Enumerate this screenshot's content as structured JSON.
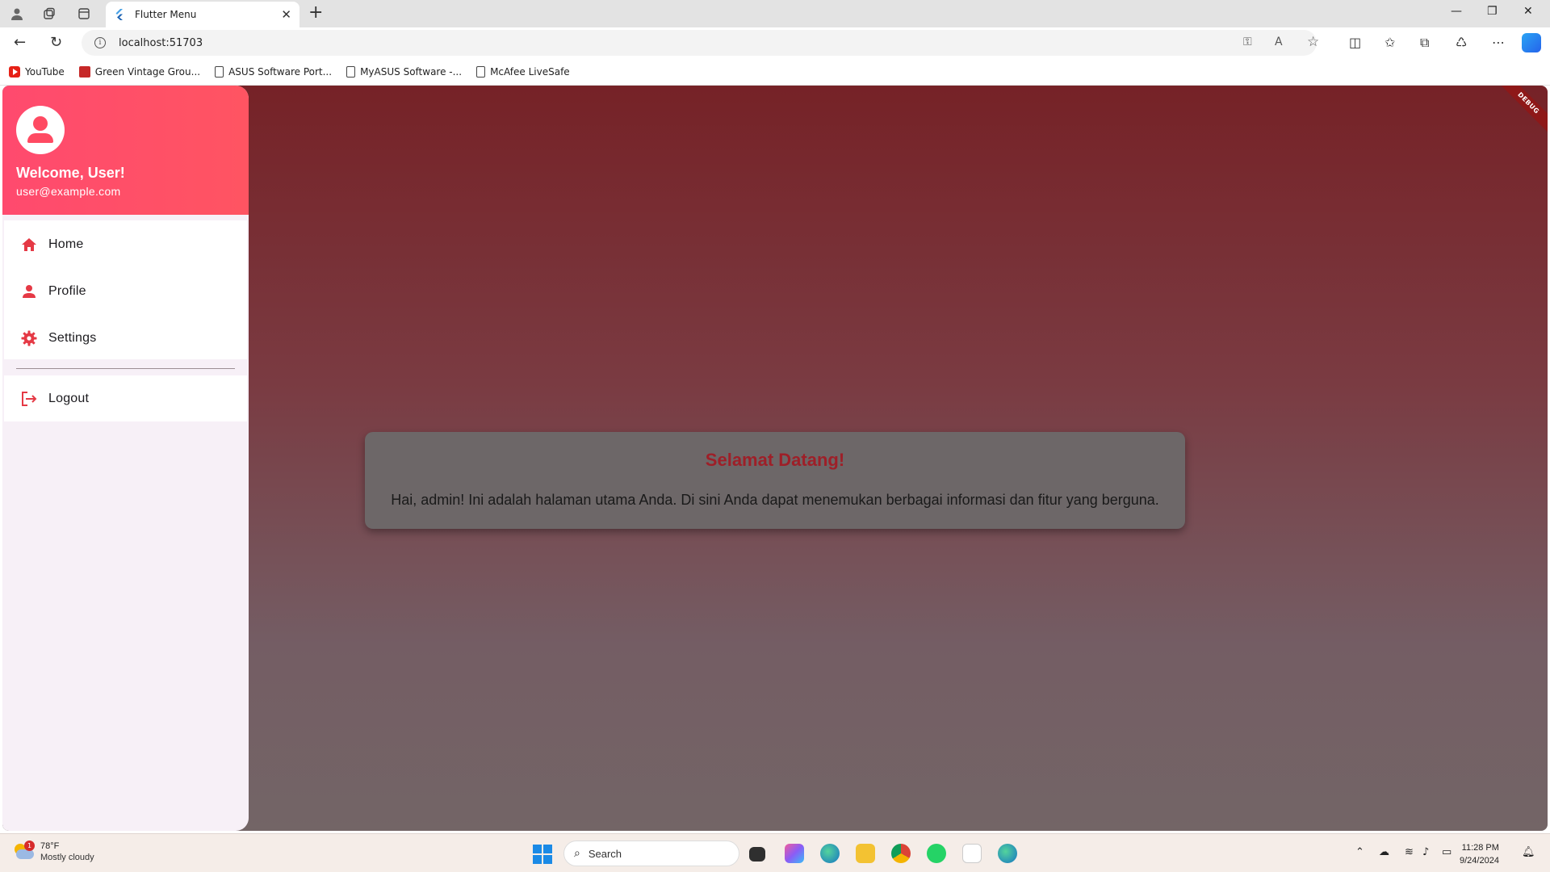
{
  "browser": {
    "tab_title": "Flutter Menu",
    "url": "localhost:51703",
    "bookmarks": [
      {
        "label": "YouTube",
        "icon": "youtube-icon"
      },
      {
        "label": "Green Vintage Grou...",
        "icon": "bookmark-favicon-icon"
      },
      {
        "label": "ASUS Software Port...",
        "icon": "page-icon"
      },
      {
        "label": "MyASUS Software -...",
        "icon": "page-icon"
      },
      {
        "label": "McAfee LiveSafe",
        "icon": "page-icon"
      }
    ]
  },
  "app": {
    "debug_banner": "DEBUG",
    "drawer": {
      "header": {
        "name": "Welcome, User!",
        "email": "user@example.com",
        "colors": {
          "gradient_start": "#ff4a6e",
          "gradient_end": "#ff5462"
        }
      },
      "items": [
        {
          "label": "Home",
          "icon": "home-icon"
        },
        {
          "label": "Profile",
          "icon": "person-icon"
        },
        {
          "label": "Settings",
          "icon": "gear-icon"
        }
      ],
      "logout": {
        "label": "Logout",
        "icon": "logout-icon"
      },
      "icon_color": "#e53945"
    },
    "content": {
      "title": "Selamat Datang!",
      "message": "Hai, admin! Ini adalah halaman utama Anda. Di sini Anda dapat menemukan berbagai informasi dan fitur yang berguna.",
      "title_color": "#9e1f28"
    }
  },
  "taskbar": {
    "weather": {
      "temp": "78°F",
      "desc": "Mostly cloudy",
      "badge": "1"
    },
    "search_placeholder": "Search",
    "time": "11:28 PM",
    "date": "9/24/2024"
  }
}
